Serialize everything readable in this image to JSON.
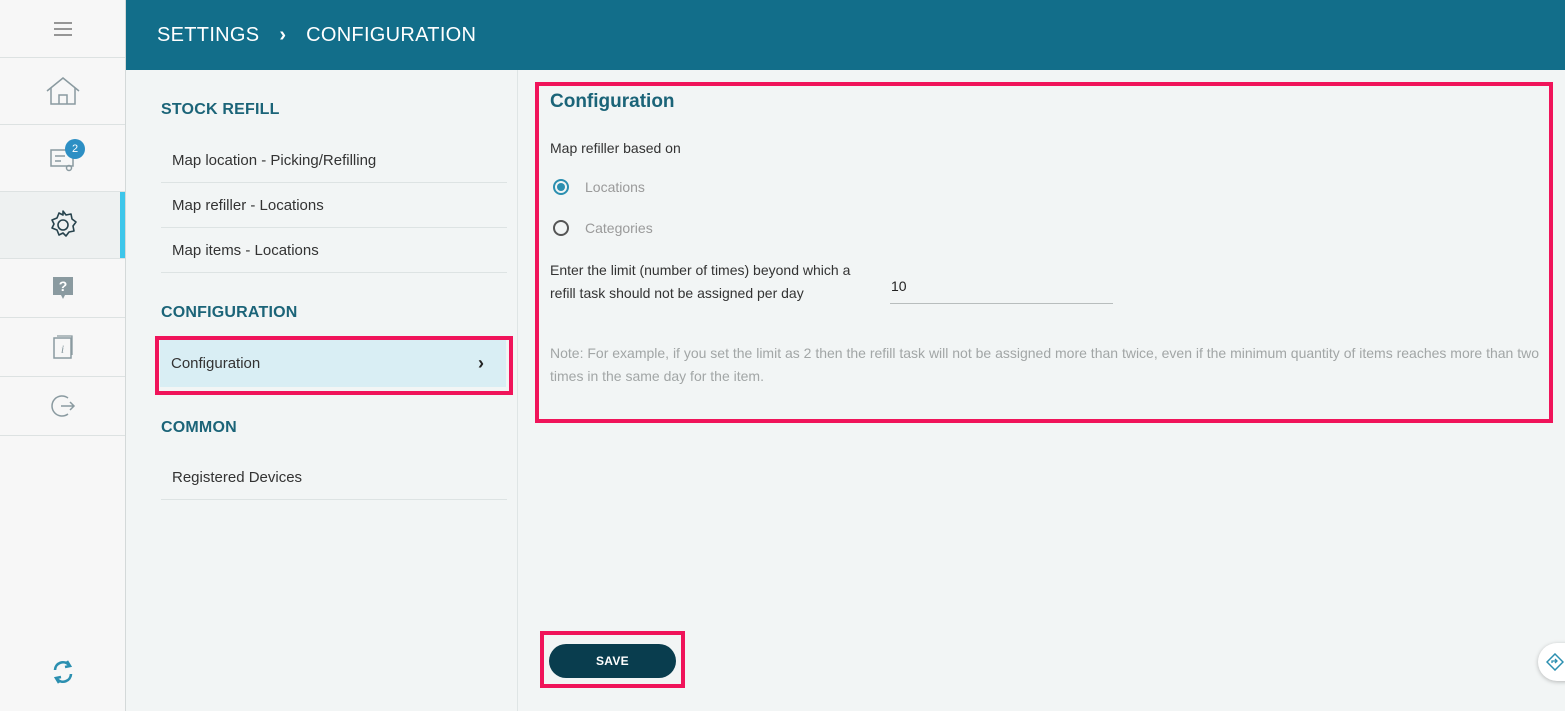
{
  "header": {
    "crumb_settings": "SETTINGS",
    "crumb_separator": "›",
    "crumb_configuration": "CONFIGURATION"
  },
  "rail": {
    "badge_count": "2"
  },
  "menu": {
    "stock_refill_title": "STOCK REFILL",
    "stock_refill_items": [
      "Map location - Picking/Refilling",
      "Map refiller - Locations",
      "Map items - Locations"
    ],
    "configuration_title": "CONFIGURATION",
    "configuration_item": "Configuration",
    "common_title": "COMMON",
    "common_items": [
      "Registered Devices"
    ]
  },
  "content": {
    "title": "Configuration",
    "map_refiller_label": "Map refiller based on",
    "radio_options": [
      {
        "label": "Locations",
        "checked": true
      },
      {
        "label": "Categories",
        "checked": false
      }
    ],
    "limit_label": "Enter the limit (number of times) beyond which a refill task should not be assigned per day",
    "limit_value": "10",
    "note": "Note: For example, if you set the limit as 2 then the refill task will not be assigned more than twice, even if the minimum quantity of items reaches more than two times in the same day for the item.",
    "save_label": "SAVE"
  },
  "colors": {
    "header_bg": "#126e8a",
    "accent": "#3ec6ea",
    "highlight": "#f0145a",
    "save_bg": "#093d4e",
    "section_title": "#1b6478"
  }
}
